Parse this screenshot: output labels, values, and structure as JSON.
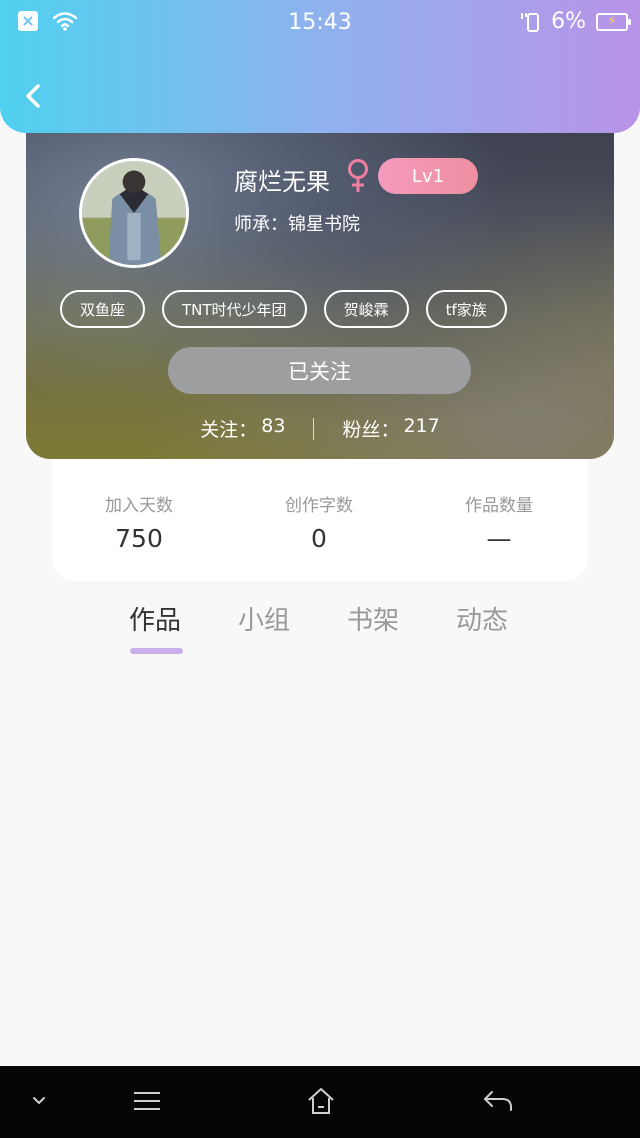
{
  "status_bar": {
    "time": "15:43",
    "battery_percent": "6%",
    "icons": [
      "sim-error-icon",
      "wifi-icon",
      "signal-icon",
      "battery-charging-icon"
    ]
  },
  "nav": {
    "back_icon": "chevron-left-icon"
  },
  "profile": {
    "username": "腐烂无果",
    "gender_icon": "female-icon",
    "level": "Lv1",
    "mentor": "师承：锦星书院",
    "tags": [
      "双鱼座",
      "TNT时代少年团",
      "贺峻霖",
      "tf家族"
    ],
    "follow_button": "已关注",
    "following": {
      "label": "关注：",
      "value": "83"
    },
    "fans": {
      "label": "粉丝：",
      "value": "217"
    }
  },
  "stats": [
    {
      "label": "加入天数",
      "value": "750"
    },
    {
      "label": "创作字数",
      "value": "0"
    },
    {
      "label": "作品数量",
      "value": "—"
    }
  ],
  "tabs": {
    "items": [
      "作品",
      "小组",
      "书架",
      "动态"
    ],
    "active_index": 0
  },
  "system_nav": [
    "chevron-down-icon",
    "menu-icon",
    "home-icon",
    "back-arrow-icon"
  ],
  "colors": {
    "header_gradient": [
      "#4fd0ef",
      "#b993e8"
    ],
    "level_badge": "#f28fb0",
    "female_icon": "#ef7fa0",
    "tab_indicator": "#c9aeea",
    "follow_button": "#9d9ea0"
  }
}
